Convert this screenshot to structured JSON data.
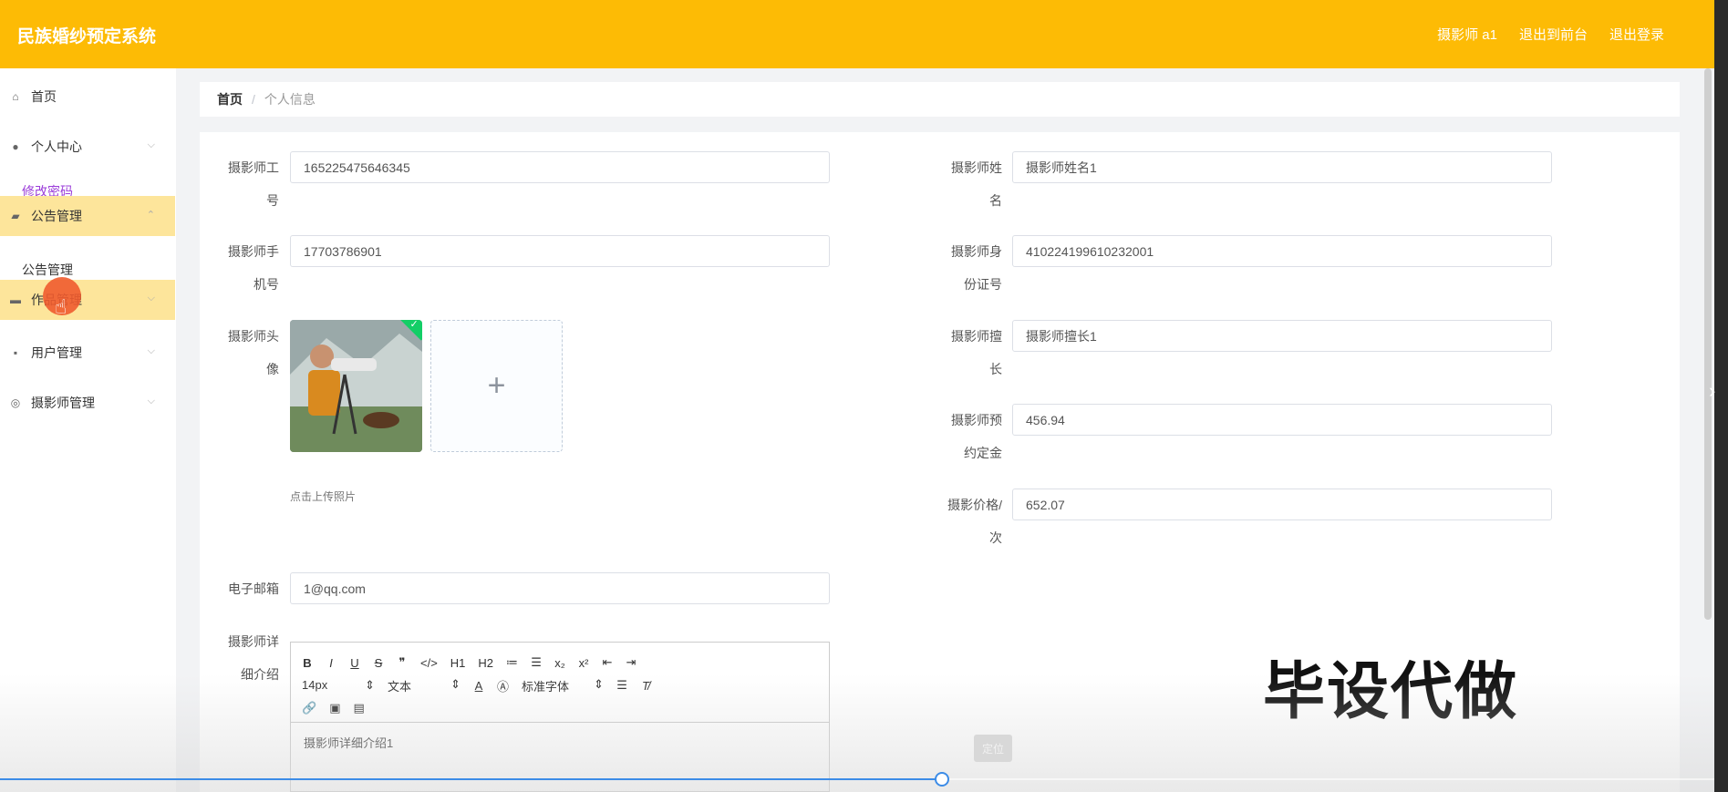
{
  "header": {
    "title": "民族婚纱预定系统",
    "user": "摄影师 a1",
    "to_front": "退出到前台",
    "logout": "退出登录"
  },
  "sidebar": {
    "items": [
      {
        "label": "首页",
        "icon": "home-icon"
      },
      {
        "label": "个人中心",
        "icon": "user-icon"
      },
      {
        "label": "修改密码"
      },
      {
        "label": "公告管理",
        "icon": "folder-icon"
      },
      {
        "label": "公告管理"
      },
      {
        "label": "作品管理",
        "icon": "briefcase-icon"
      },
      {
        "label": "用户管理",
        "icon": "chat-icon"
      },
      {
        "label": "摄影师管理",
        "icon": "globe-icon"
      }
    ]
  },
  "breadcrumb": {
    "home": "首页",
    "sep": "/",
    "current": "个人信息"
  },
  "form": {
    "labels": {
      "id": [
        "摄影师工",
        "号"
      ],
      "name": [
        "摄影师姓",
        "名"
      ],
      "phone": [
        "摄影师手",
        "机号"
      ],
      "idcard": [
        "摄影师身",
        "份证号"
      ],
      "avatar": [
        "摄影师头",
        "像"
      ],
      "specialty": [
        "摄影师擅",
        "长"
      ],
      "deposit": [
        "摄影师预",
        "约定金"
      ],
      "price": [
        "摄影价格/",
        "次"
      ],
      "email": [
        "电子邮箱"
      ],
      "detail": [
        "摄影师详",
        "细介绍"
      ]
    },
    "values": {
      "id": "165225475646345",
      "name": "摄影师姓名1",
      "phone": "17703786901",
      "idcard": "410224199610232001",
      "specialty": "摄影师擅长1",
      "deposit": "456.94",
      "price": "652.07",
      "email": "1@qq.com",
      "detail": "摄影师详细介绍1"
    },
    "upload_tip": "点击上传照片",
    "upload_plus": "+"
  },
  "editor": {
    "row1": [
      "B",
      "I",
      "U",
      "S",
      "❞",
      "</>",
      "H1",
      "H2",
      "≔",
      "☰",
      "x₂",
      "x²",
      "⇤",
      "⇥"
    ],
    "size": "14px",
    "block": "文本",
    "font": "标准字体",
    "row2_tail": [
      "A",
      "Ⓐ"
    ],
    "row3": [
      "🔗",
      "▣",
      "▤"
    ]
  },
  "locate_button": "定位",
  "watermark": "毕设代做",
  "video_progress": 0.545,
  "colors": {
    "topbar": "#fdbb05",
    "active_menu": "#fde59b",
    "link_purple": "#9b3dd9",
    "progress": "#3c8ce7"
  }
}
